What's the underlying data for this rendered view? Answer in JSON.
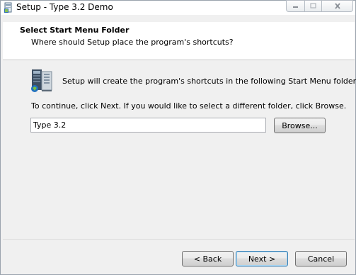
{
  "window": {
    "title": "Setup - Type 3.2 Demo"
  },
  "header": {
    "title": "Select Start Menu Folder",
    "subtitle": "Where should Setup place the program's shortcuts?"
  },
  "body": {
    "intro": "Setup will create the program's shortcuts in the following Start Menu folder.",
    "instructions": "To continue, click Next. If you would like to select a different folder, click Browse.",
    "folder_value": "Type 3.2",
    "browse_label": "Browse..."
  },
  "footer": {
    "back_label": "< Back",
    "next_label": "Next >",
    "cancel_label": "Cancel"
  },
  "icons": {
    "app": "installer-icon",
    "folder": "start-menu-folder-icon",
    "minimize": "minimize-icon",
    "maximize": "maximize-icon",
    "close": "close-icon"
  }
}
